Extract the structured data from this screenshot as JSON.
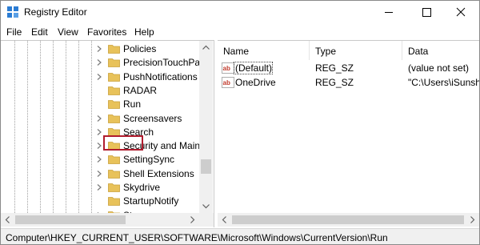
{
  "window": {
    "title": "Registry Editor"
  },
  "menu": [
    "File",
    "Edit",
    "View",
    "Favorites",
    "Help"
  ],
  "tree": {
    "items": [
      {
        "label": "Policies",
        "expandable": true
      },
      {
        "label": "PrecisionTouchPad",
        "expandable": true
      },
      {
        "label": "PushNotifications",
        "expandable": true
      },
      {
        "label": "RADAR",
        "expandable": false
      },
      {
        "label": "Run",
        "expandable": false,
        "selected": true
      },
      {
        "label": "Screensavers",
        "expandable": true
      },
      {
        "label": "Search",
        "expandable": true
      },
      {
        "label": "Security and Maint",
        "expandable": true
      },
      {
        "label": "SettingSync",
        "expandable": true
      },
      {
        "label": "Shell Extensions",
        "expandable": true
      },
      {
        "label": "Skydrive",
        "expandable": true
      },
      {
        "label": "StartupNotify",
        "expandable": false
      },
      {
        "label": "Store",
        "expandable": true
      }
    ]
  },
  "list": {
    "columns": [
      "Name",
      "Type",
      "Data"
    ],
    "rows": [
      {
        "name": "(Default)",
        "type": "REG_SZ",
        "data": "(value not set)"
      },
      {
        "name": "OneDrive",
        "type": "REG_SZ",
        "data": "\"C:\\Users\\iSunsha"
      }
    ]
  },
  "status": {
    "path": "Computer\\HKEY_CURRENT_USER\\SOFTWARE\\Microsoft\\Windows\\CurrentVersion\\Run"
  },
  "colors": {
    "selection_outline": "#b01c2e",
    "folder": "#e8c25a",
    "reg_icon": "#c0392b"
  }
}
